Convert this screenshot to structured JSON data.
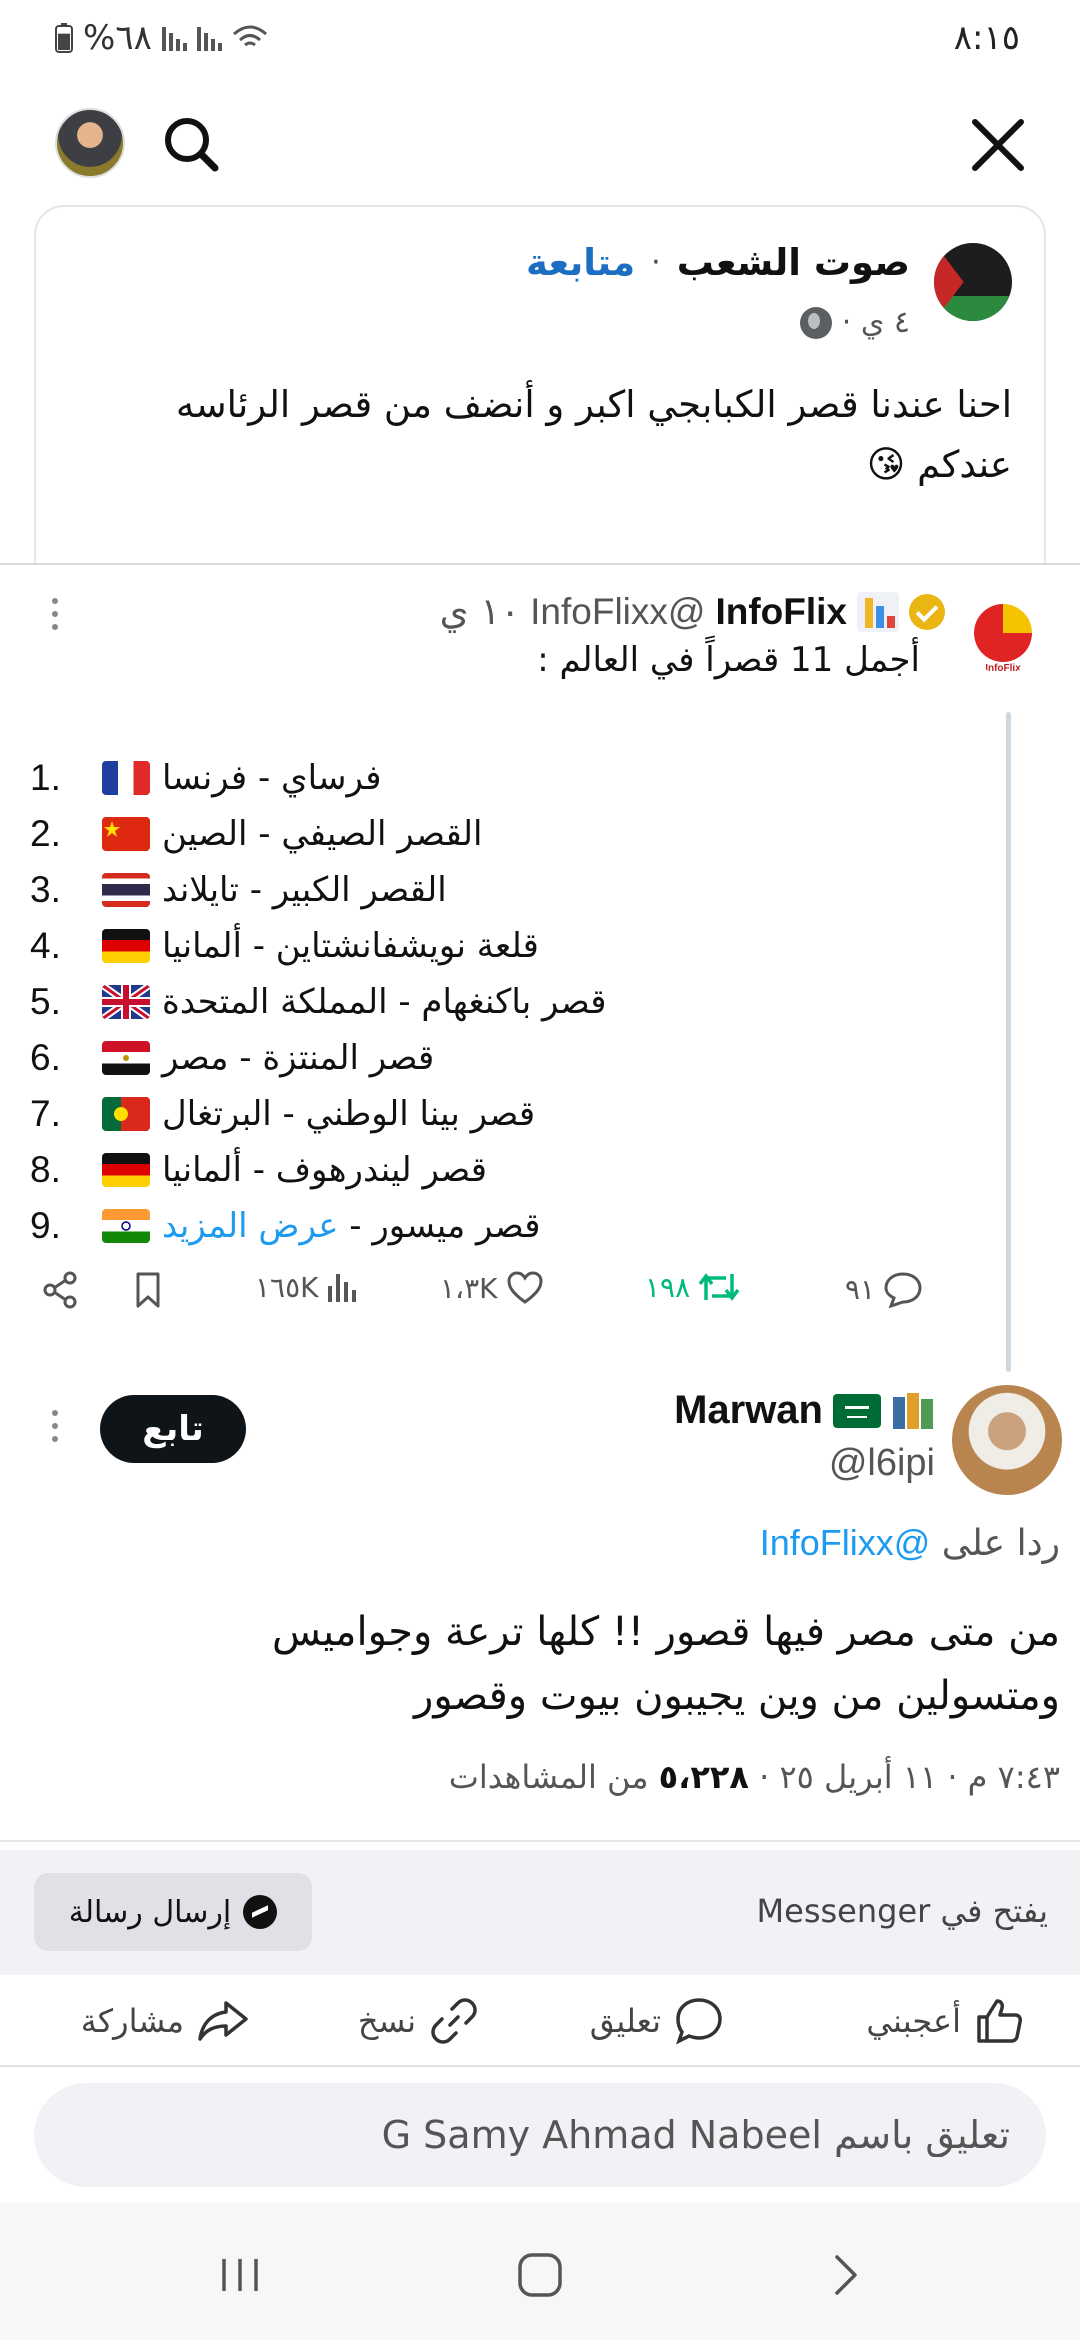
{
  "status_bar": {
    "time": "٨:١٥",
    "battery_percent": "%٦٨",
    "battery_level": 0.68
  },
  "top_bar": {
    "avatar_icon": "profile-avatar",
    "search_icon": "search-icon",
    "close_icon": "close-icon"
  },
  "post": {
    "page_name": "صوت الشعب",
    "separator": "·",
    "follow_label": "متابعة",
    "time": "٤ ي ·",
    "privacy_icon": "globe-icon",
    "text": "احنا عندنا قصر الكبابجي اكبر و أنضف من قصر الرئاسه عندكم 😘"
  },
  "tweet": {
    "name": "InfoFlix",
    "handle": "@InfoFlixx",
    "time": "١٠ ي",
    "intro": "أجمل 11 قصراً في العالم :",
    "castles": [
      {
        "num": "1.",
        "flag": "france",
        "name": "فرساي - فرنسا"
      },
      {
        "num": "2.",
        "flag": "china",
        "name": "القصر الصيفي - الصين"
      },
      {
        "num": "3.",
        "flag": "thailand",
        "name": "القصر الكبير - تايلاند"
      },
      {
        "num": "4.",
        "flag": "germany",
        "name": "قلعة نويشفانشتاين - ألمانيا"
      },
      {
        "num": "5.",
        "flag": "uk",
        "name": "قصر باكنغهام - المملكة المتحدة"
      },
      {
        "num": "6.",
        "flag": "egypt",
        "name": "قصر المنتزة - مصر"
      },
      {
        "num": "7.",
        "flag": "portugal",
        "name": "قصر بينا الوطني - البرتغال"
      },
      {
        "num": "8.",
        "flag": "germany",
        "name": "قصر ليندرهوف - ألمانيا"
      },
      {
        "num": "9.",
        "flag": "india",
        "name": "قصر ميسور - "
      }
    ],
    "see_more": "عرض المزيد",
    "actions": {
      "replies": "٩١",
      "retweets": "١٩٨",
      "likes": "١،٣K",
      "views": "١٦٥K"
    }
  },
  "reply": {
    "name": "Marwan",
    "handle": "@l6ipi",
    "follow_label": "تابع",
    "replying_to_label": "ردا على",
    "replying_to_handle": "@InfoFlixx",
    "text_line1": "من متى مصر فيها قصور !! كلها ترعة وجواميس",
    "text_line2": "ومتسولين من وين يجيبون بيوت وقصور",
    "meta_prefix": "٧:٤٣ م · ١١ أبريل ٢٥ · ",
    "views_count": "٥،٢٢٨",
    "views_suffix": " من المشاهدات"
  },
  "messenger": {
    "opens_in": "يفتح في Messenger",
    "send_label": "إرسال رسالة"
  },
  "post_actions": {
    "like": "أعجبني",
    "comment": "تعليق",
    "copy": "نسخ",
    "share": "مشاركة"
  },
  "comment": {
    "placeholder": "تعليق باسم G Samy Ahmad Nabeel"
  },
  "colors": {
    "link_blue": "#1b6ec2",
    "twitter_blue": "#1d9bf0",
    "retweet_green": "#00ba7c"
  }
}
